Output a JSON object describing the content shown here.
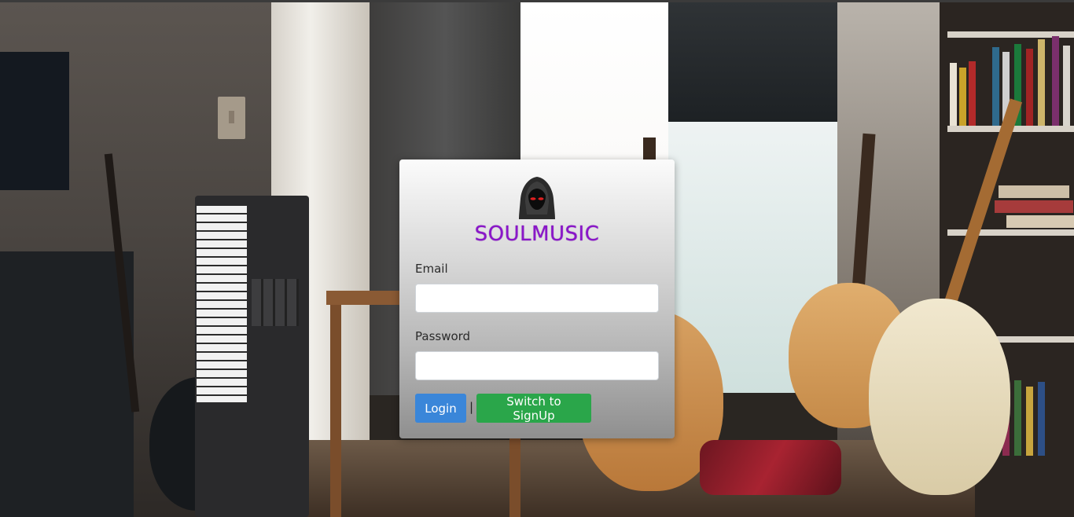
{
  "brand": {
    "name": "SOULMUSIC",
    "color": "#8a16c9"
  },
  "form": {
    "email_label": "Email",
    "email_value": "",
    "password_label": "Password",
    "password_value": "",
    "login_label": "Login",
    "separator": "|",
    "switch_label": "Switch to SignUp"
  },
  "colors": {
    "login_button": "#3a86d9",
    "switch_button": "#2aa64a"
  },
  "icons": {
    "logo": "hooded-figure-icon"
  }
}
